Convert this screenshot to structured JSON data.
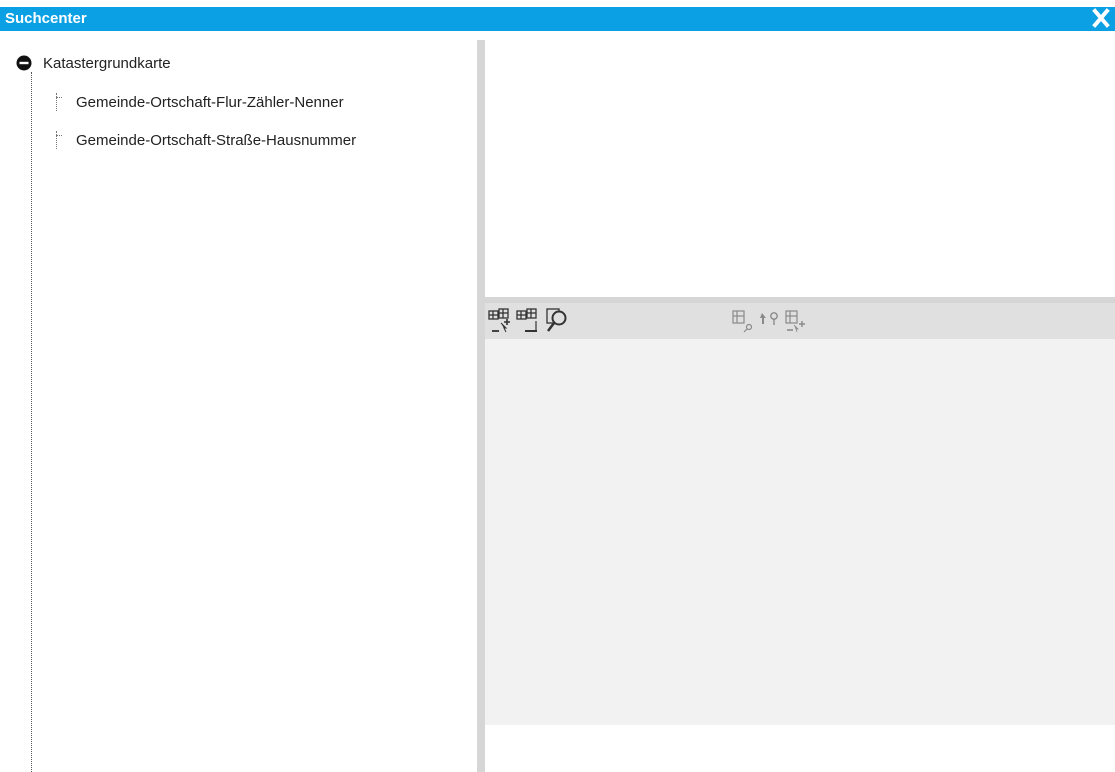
{
  "window": {
    "title": "Suchcenter",
    "close_icon": "close-icon"
  },
  "tree": {
    "root": {
      "label": "Katastergrundkarte",
      "expanded": true,
      "icon": "collapse-icon"
    },
    "children": [
      {
        "label": "Gemeinde-Ortschaft-Flur-Zähler-Nenner"
      },
      {
        "label": "Gemeinde-Ortschaft-Straße-Hausnummer"
      }
    ]
  },
  "toolbar": {
    "left_tools": [
      {
        "icon": "add-to-selection-icon",
        "enabled": true
      },
      {
        "icon": "remove-from-selection-icon",
        "enabled": true
      },
      {
        "icon": "zoom-to-selection-icon",
        "enabled": true
      }
    ],
    "right_tools": [
      {
        "icon": "search-object-icon",
        "enabled": false
      },
      {
        "icon": "pick-location-icon",
        "enabled": false
      },
      {
        "icon": "add-object-icon",
        "enabled": false
      }
    ]
  },
  "colors": {
    "titlebar": "#0aa0e3",
    "splitter": "#d6d6d6",
    "toolbar": "#e0e0e0",
    "map_background": "#f2f2f2"
  }
}
